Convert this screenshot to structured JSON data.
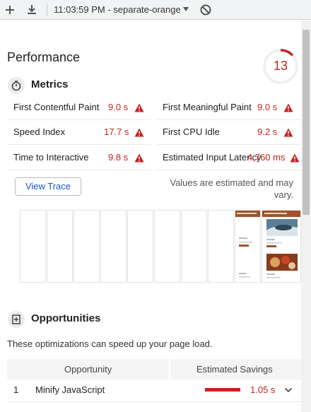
{
  "toolbar": {
    "new_icon": "plus-icon",
    "download_icon": "download-icon",
    "report_label": "11:03:59 PM - separate-orange",
    "caret_icon": "caret-down-icon",
    "clear_icon": "block-icon"
  },
  "performance": {
    "title": "Performance",
    "score": "13",
    "score_fraction": 0.13,
    "score_color": "#c7221f"
  },
  "metrics": {
    "title": "Metrics",
    "icon": "stopwatch-icon",
    "items": [
      {
        "label": "First Contentful Paint",
        "value": "9.0 s"
      },
      {
        "label": "First Meaningful Paint",
        "value": "9.0 s"
      },
      {
        "label": "Speed Index",
        "value": "17.7 s"
      },
      {
        "label": "First CPU Idle",
        "value": "9.2 s"
      },
      {
        "label": "Time to Interactive",
        "value": "9.8 s"
      },
      {
        "label": "Estimated Input Latency",
        "value": "4,760 ms"
      }
    ],
    "view_trace_label": "View Trace",
    "estimate_note": "Values are estimated and may vary."
  },
  "filmstrip": {
    "frames": 11,
    "thumb_title": "Tony's Favorite Foods"
  },
  "opportunities": {
    "title": "Opportunities",
    "icon": "opportunity-icon",
    "description": "These optimizations can speed up your page load.",
    "col_opportunity": "Opportunity",
    "col_savings": "Estimated Savings",
    "rows": [
      {
        "index": "1",
        "name": "Minify JavaScript",
        "savings": "1.05 s",
        "bar_fraction": 0.33
      }
    ]
  },
  "colors": {
    "fail": "#c7221f",
    "link": "#1a56c6"
  }
}
